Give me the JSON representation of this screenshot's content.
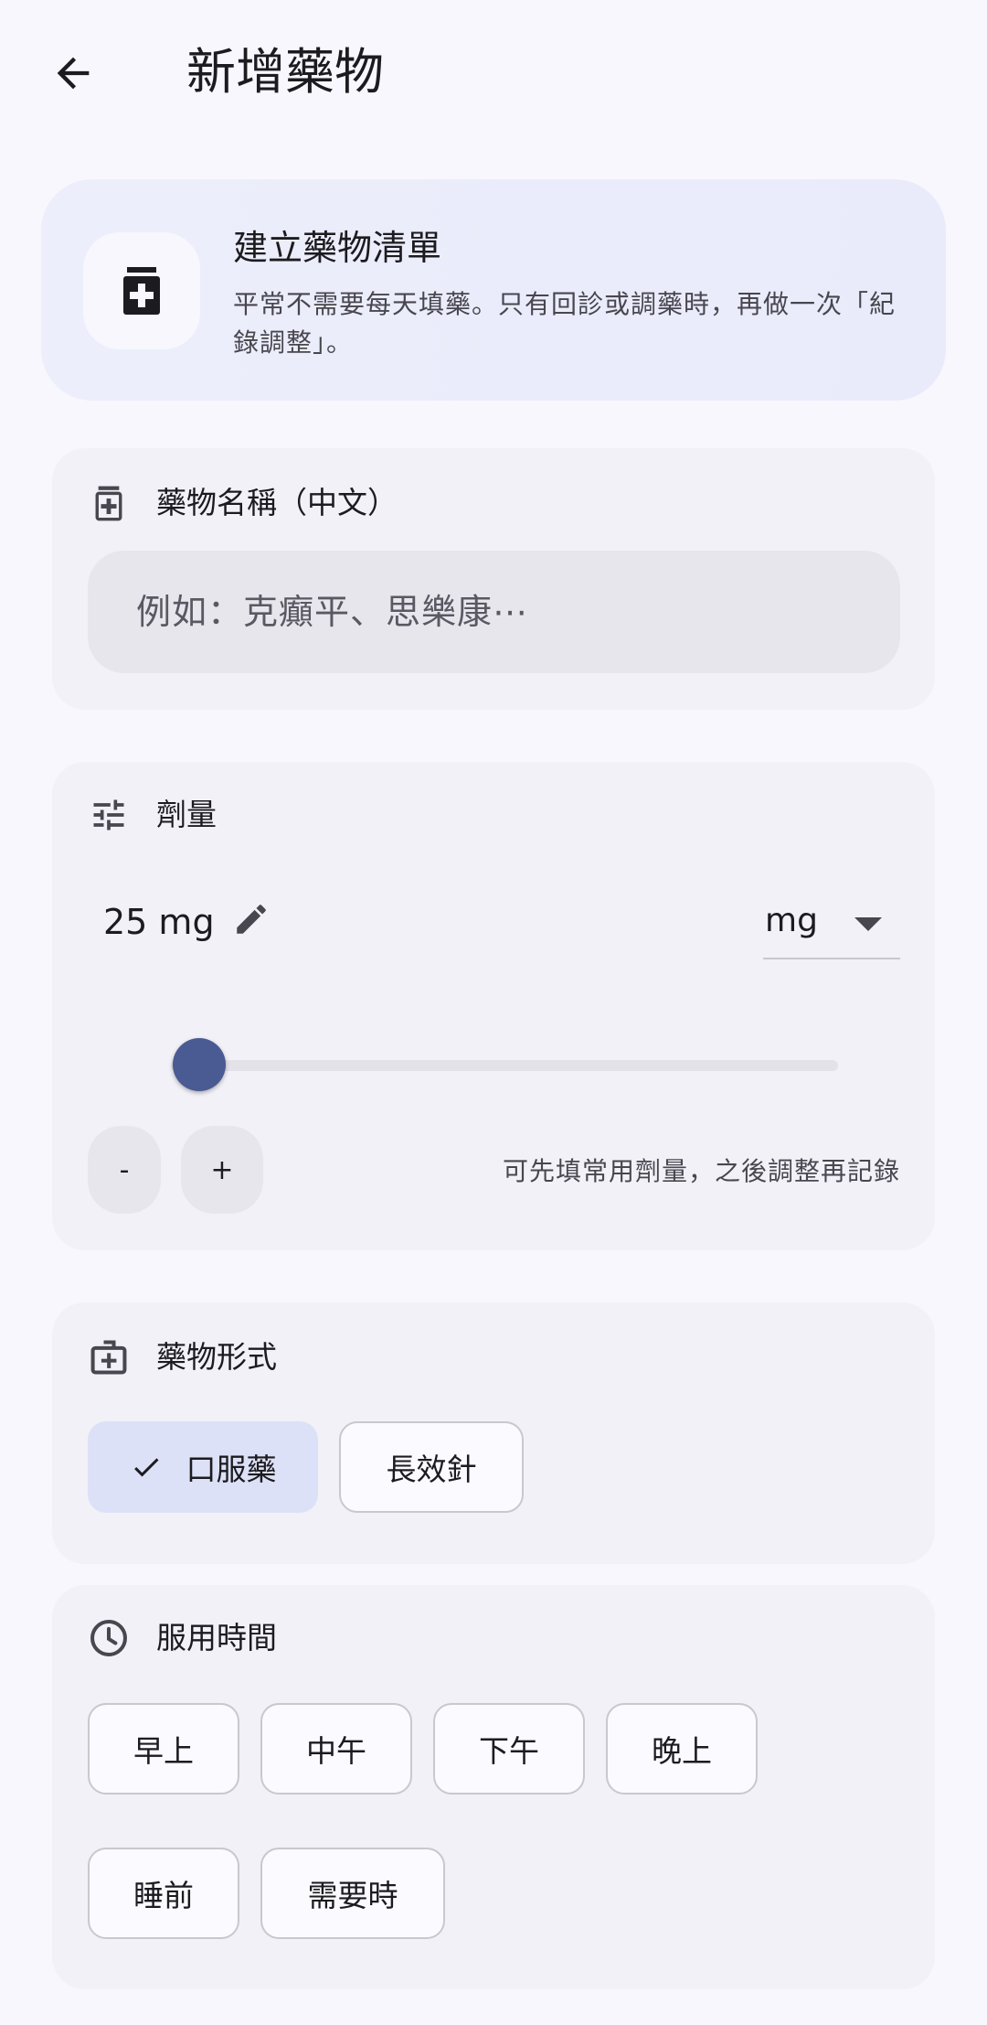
{
  "header": {
    "title": "新增藥物",
    "back_icon": "arrow-back-icon"
  },
  "hero": {
    "title": "建立藥物清單",
    "description": "平常不需要每天填藥。只有回診或調藥時，再做一次「紀錄調整」。",
    "icon": "medication-icon"
  },
  "name_section": {
    "label": "藥物名稱（中文）",
    "icon": "medication-icon",
    "input_value": "",
    "input_placeholder": "例如：克癲平、思樂康⋯"
  },
  "dose_section": {
    "label": "劑量",
    "icon": "tune-icon",
    "value_text": "25 mg",
    "unit": "mg",
    "slider_fraction": 0.02,
    "minus_label": "-",
    "plus_label": "+",
    "hint": "可先填常用劑量，之後調整再記錄",
    "slider_color": "#4a5a92"
  },
  "form_section": {
    "label": "藥物形式",
    "icon": "medical-bag-icon",
    "options": [
      {
        "label": "口服藥",
        "selected": true
      },
      {
        "label": "長效針",
        "selected": false
      }
    ]
  },
  "time_section": {
    "label": "服用時間",
    "icon": "clock-icon",
    "options": [
      {
        "label": "早上",
        "selected": false
      },
      {
        "label": "中午",
        "selected": false
      },
      {
        "label": "下午",
        "selected": false
      },
      {
        "label": "晚上",
        "selected": false
      },
      {
        "label": "睡前",
        "selected": false
      },
      {
        "label": "需要時",
        "selected": false
      }
    ]
  },
  "colors": {
    "background": "#f8f7fd",
    "card": "#f2f1f8",
    "selected_chip": "#dde1f7",
    "accent": "#4a5a92"
  }
}
